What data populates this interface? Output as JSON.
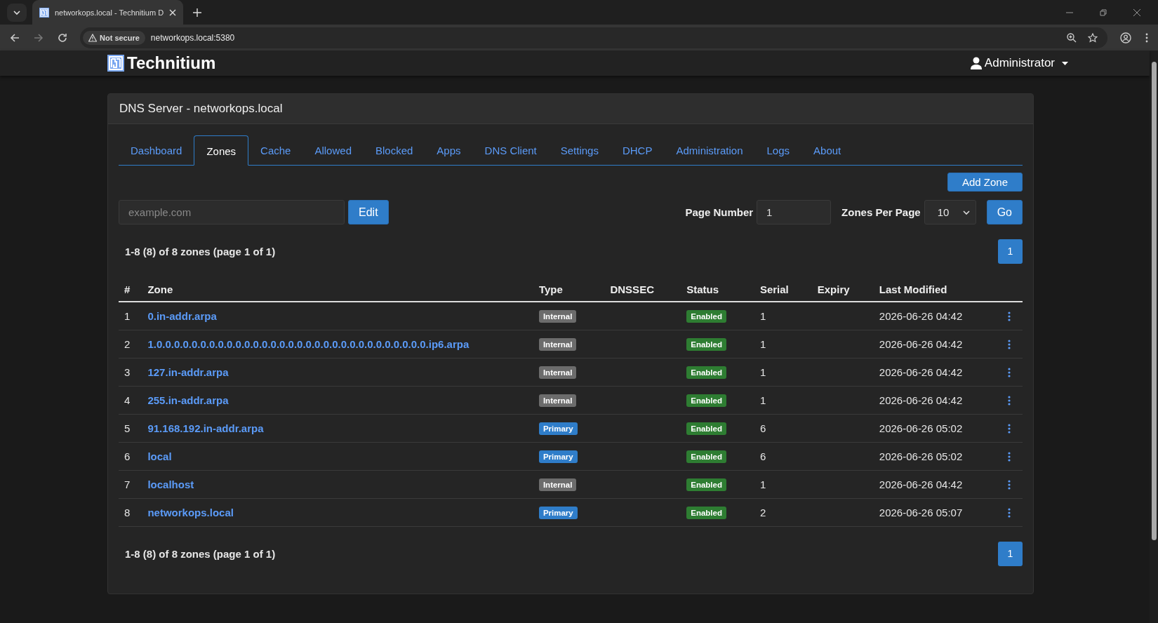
{
  "browser": {
    "tabs": [
      {
        "title": "networkops.local - Technitium D",
        "selected": true
      }
    ],
    "security": "Not secure",
    "url": "networkops.local:5380"
  },
  "app": {
    "brand": "Technitium",
    "user": "Administrator"
  },
  "panel": {
    "title": "DNS Server - networkops.local",
    "tabs": [
      {
        "label": "Dashboard",
        "selected": false
      },
      {
        "label": "Zones",
        "selected": true
      },
      {
        "label": "Cache",
        "selected": false
      },
      {
        "label": "Allowed",
        "selected": false
      },
      {
        "label": "Blocked",
        "selected": false
      },
      {
        "label": "Apps",
        "selected": false
      },
      {
        "label": "DNS Client",
        "selected": false
      },
      {
        "label": "Settings",
        "selected": false
      },
      {
        "label": "DHCP",
        "selected": false
      },
      {
        "label": "Administration",
        "selected": false
      },
      {
        "label": "Logs",
        "selected": false
      },
      {
        "label": "About",
        "selected": false
      }
    ],
    "add_zone_button": "Add Zone",
    "search": {
      "placeholder": "example.com"
    },
    "edit_button": "Edit",
    "page_number": {
      "label": "Page Number",
      "value": "1"
    },
    "zones_per_page": {
      "label": "Zones Per Page",
      "value": "10"
    },
    "go_button": "Go",
    "summary_top": "1-8 (8) of 8 zones (page 1 of 1)",
    "pagination_top": [
      {
        "label": "1",
        "selected": true
      }
    ],
    "columns": [
      "#",
      "Zone",
      "Type",
      "DNSSEC",
      "Status",
      "Serial",
      "Expiry",
      "Last Modified"
    ],
    "rows": [
      {
        "number": "1",
        "zone": "0.in-addr.arpa",
        "type": {
          "label": "Internal",
          "kind": "internal"
        },
        "status": {
          "label": "Enabled",
          "kind": "enabled"
        },
        "serial": "1",
        "last_modified": "2026-06-26 04:42"
      },
      {
        "number": "2",
        "zone": "1.0.0.0.0.0.0.0.0.0.0.0.0.0.0.0.0.0.0.0.0.0.0.0.0.0.0.0.0.0.0.0.ip6.arpa",
        "type": {
          "label": "Internal",
          "kind": "internal"
        },
        "status": {
          "label": "Enabled",
          "kind": "enabled"
        },
        "serial": "1",
        "last_modified": "2026-06-26 04:42"
      },
      {
        "number": "3",
        "zone": "127.in-addr.arpa",
        "type": {
          "label": "Internal",
          "kind": "internal"
        },
        "status": {
          "label": "Enabled",
          "kind": "enabled"
        },
        "serial": "1",
        "last_modified": "2026-06-26 04:42"
      },
      {
        "number": "4",
        "zone": "255.in-addr.arpa",
        "type": {
          "label": "Internal",
          "kind": "internal"
        },
        "status": {
          "label": "Enabled",
          "kind": "enabled"
        },
        "serial": "1",
        "last_modified": "2026-06-26 04:42"
      },
      {
        "number": "5",
        "zone": "91.168.192.in-addr.arpa",
        "type": {
          "label": "Primary",
          "kind": "primary"
        },
        "status": {
          "label": "Enabled",
          "kind": "enabled"
        },
        "serial": "6",
        "last_modified": "2026-06-26 05:02"
      },
      {
        "number": "6",
        "zone": "local",
        "type": {
          "label": "Primary",
          "kind": "primary"
        },
        "status": {
          "label": "Enabled",
          "kind": "enabled"
        },
        "serial": "6",
        "last_modified": "2026-06-26 05:02"
      },
      {
        "number": "7",
        "zone": "localhost",
        "type": {
          "label": "Internal",
          "kind": "internal"
        },
        "status": {
          "label": "Enabled",
          "kind": "enabled"
        },
        "serial": "1",
        "last_modified": "2026-06-26 04:42"
      },
      {
        "number": "8",
        "zone": "networkops.local",
        "type": {
          "label": "Primary",
          "kind": "primary"
        },
        "status": {
          "label": "Enabled",
          "kind": "enabled"
        },
        "serial": "2",
        "last_modified": "2026-06-26 05:07"
      }
    ],
    "summary_bottom": "1-8 (8) of 8 zones (page 1 of 1)",
    "pagination_bottom": [
      {
        "label": "1",
        "selected": true
      }
    ]
  }
}
